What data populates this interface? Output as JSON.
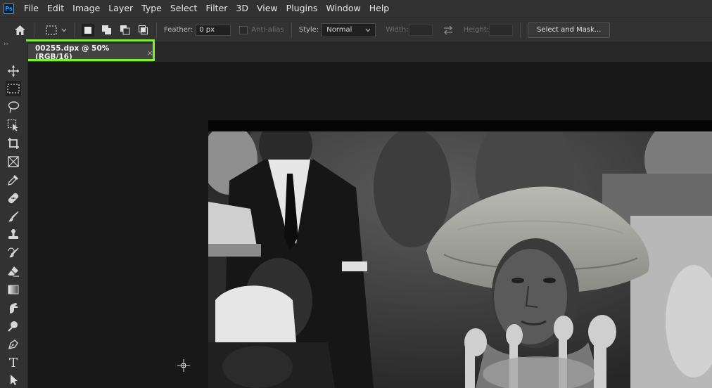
{
  "app": {
    "logo_text": "Ps"
  },
  "menu": [
    "File",
    "Edit",
    "Image",
    "Layer",
    "Type",
    "Select",
    "Filter",
    "3D",
    "View",
    "Plugins",
    "Window",
    "Help"
  ],
  "options": {
    "feather_label": "Feather:",
    "feather_value": "0 px",
    "anti_alias_label": "Anti-alias",
    "style_label": "Style:",
    "style_value": "Normal",
    "width_label": "Width:",
    "height_label": "Height:",
    "select_mask_label": "Select and Mask..."
  },
  "document": {
    "tab_title": "00255.dpx @ 50% (RGB/16)",
    "close_glyph": "×"
  },
  "toolbar": {
    "collapse_glyph": "››",
    "tools": [
      "move-tool",
      "rectangular-marquee-tool",
      "lasso-tool",
      "object-selection-tool",
      "crop-tool",
      "frame-tool",
      "eyedropper-tool",
      "spot-healing-brush-tool",
      "brush-tool",
      "clone-stamp-tool",
      "history-brush-tool",
      "eraser-tool",
      "gradient-tool",
      "smudge-tool",
      "dodge-tool",
      "pen-tool",
      "type-tool",
      "path-selection-tool"
    ],
    "type_tool_glyph": "T"
  },
  "colors": {
    "accent_highlight": "#7df12c",
    "ps_blue": "#31a8ff",
    "panel": "#323232",
    "canvas_bg": "#181818"
  }
}
